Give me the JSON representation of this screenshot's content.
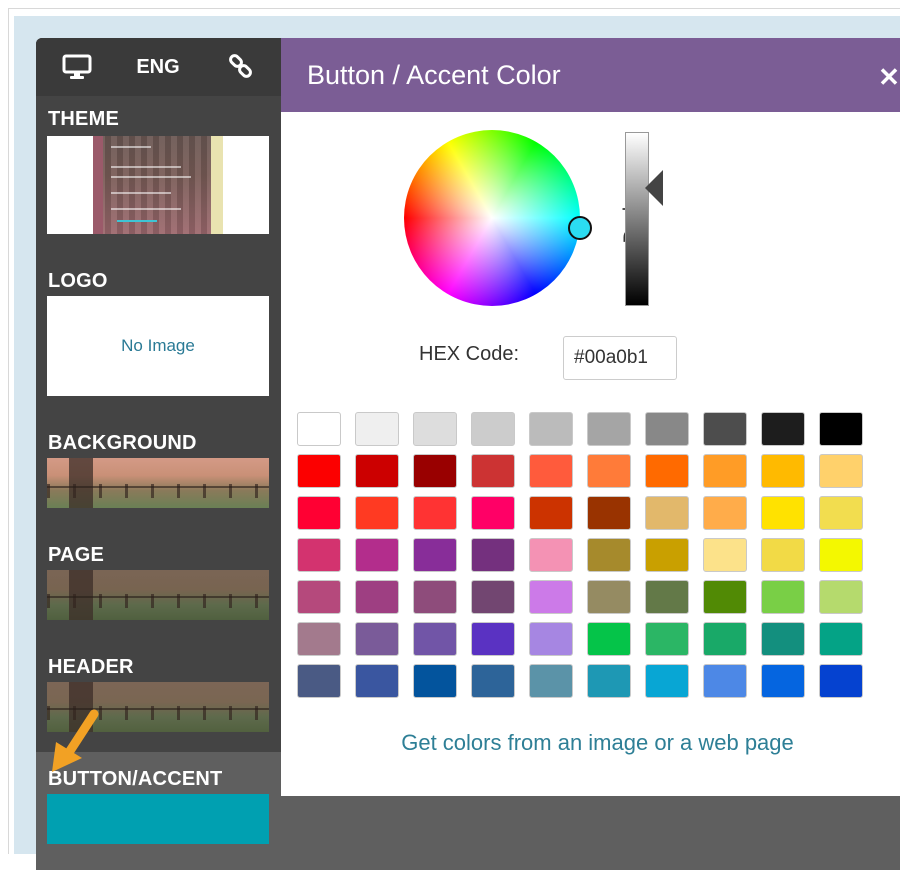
{
  "topbar": {
    "lang": "ENG",
    "desktop_icon": "desktop-monitor-icon",
    "link_icon": "chain-link-icon"
  },
  "sidebar": {
    "sections": [
      {
        "label": "THEME"
      },
      {
        "label": "LOGO",
        "thumb_text": "No Image"
      },
      {
        "label": "BACKGROUND"
      },
      {
        "label": "PAGE"
      },
      {
        "label": "HEADER"
      },
      {
        "label": "BUTTON/ACCENT"
      }
    ],
    "accent_color": "#00a0b1",
    "arrow_color": "#f2a124"
  },
  "panel": {
    "title": "Button / Accent Color",
    "close_icon": "close-x-icon",
    "darkness_label": "Darkness",
    "hex_label": "HEX Code:",
    "hex_value": "#00a0b1",
    "header_color": "#7b5d95",
    "get_colors_link": "Get colors from an image or a web page"
  },
  "swatches": [
    [
      "#ffffff",
      "#efefef",
      "#dddddd",
      "#cccccc",
      "#bbbbbb",
      "#a5a5a5",
      "#888888",
      "#4d4d4d",
      "#1d1d1d",
      "#000000"
    ],
    [
      "#fc0000",
      "#cc0000",
      "#990000",
      "#cc3333",
      "#ff5b3c",
      "#ff7b39",
      "#ff6a00",
      "#ff9c26",
      "#ffba00",
      "#ffd16b"
    ],
    [
      "#ff0033",
      "#ff3a22",
      "#ff3333",
      "#ff0066",
      "#cc3300",
      "#993300",
      "#e2b86b",
      "#ffac4a",
      "#ffe200",
      "#f2dd4f"
    ],
    [
      "#d3336f",
      "#b32d8c",
      "#882d99",
      "#74307e",
      "#f492b4",
      "#a68a2c",
      "#c9a000",
      "#fce28a",
      "#f2da46",
      "#f4f800"
    ],
    [
      "#b5497c",
      "#9e3f82",
      "#8e4c7b",
      "#724671",
      "#cc7ae8",
      "#958b62",
      "#637948",
      "#518a05",
      "#79cf46",
      "#b5da6d"
    ],
    [
      "#a37a8d",
      "#7a5b99",
      "#7155a7",
      "#5a32c2",
      "#a686e2",
      "#05c449",
      "#2bb665",
      "#19a968",
      "#138f7e",
      "#04a386"
    ],
    [
      "#4a5a84",
      "#3a56a0",
      "#03549d",
      "#2d6499",
      "#5b93a8",
      "#1e98b4",
      "#08a6d4",
      "#4d88e6",
      "#0565e0",
      "#0542d0"
    ]
  ]
}
